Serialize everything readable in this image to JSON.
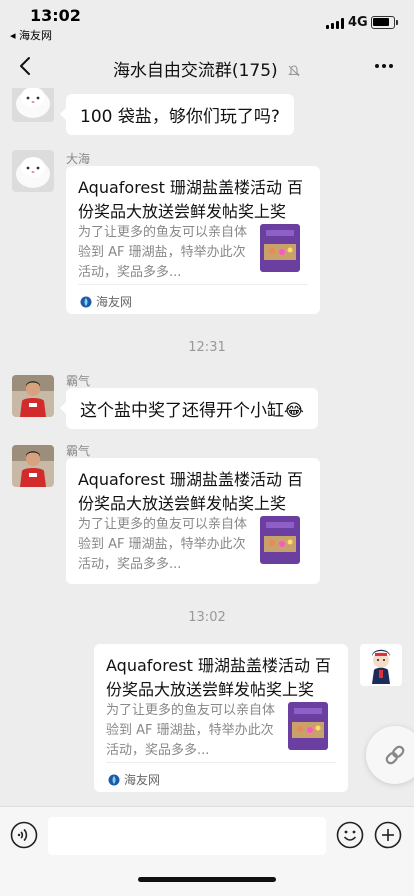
{
  "status_bar": {
    "time": "13:02",
    "back_app": "◂ 海友网",
    "network": "4G"
  },
  "nav": {
    "title": "海水自由交流群(175)"
  },
  "messages": [
    {
      "text": "100 袋盐，够你们玩了吗?"
    },
    {
      "sender": "大海",
      "card": {
        "title": "Aquaforest 珊湖盐盖楼活动 百份奖品大放送尝鲜发帖奖上奖",
        "desc": "为了让更多的鱼友可以亲自体验到 AF 珊湖盐，特举办此次活动，奖品多多...",
        "source": "海友网"
      }
    },
    {
      "timestamp": "12:31"
    },
    {
      "sender": "霸气",
      "text": "这个盐中奖了还得开个小缸😂"
    },
    {
      "sender": "霸气",
      "card": {
        "title": "Aquaforest 珊湖盐盖楼活动 百份奖品大放送尝鲜发帖奖上奖",
        "desc": "为了让更多的鱼友可以亲自体验到 AF 珊湖盐，特举办此次活动，奖品多多..."
      }
    },
    {
      "timestamp": "13:02"
    },
    {
      "card": {
        "title": "Aquaforest 珊湖盐盖楼活动 百份奖品大放送尝鲜发帖奖上奖",
        "desc": "为了让更多的鱼友可以亲自体验到 AF 珊湖盐，特举办此次活动，奖品多多...",
        "source": "海友网"
      }
    }
  ],
  "icons": [
    "back-icon",
    "mute-icon",
    "more-icon",
    "link-icon",
    "voice-icon",
    "emoji-icon",
    "plus-icon",
    "source-logo-icon"
  ],
  "colors": {
    "background": "#ededed",
    "bubble": "#ffffff",
    "input_bar": "#f6f6f6",
    "muted_text": "#888888",
    "thumb_purple": "#6b3fa0"
  }
}
